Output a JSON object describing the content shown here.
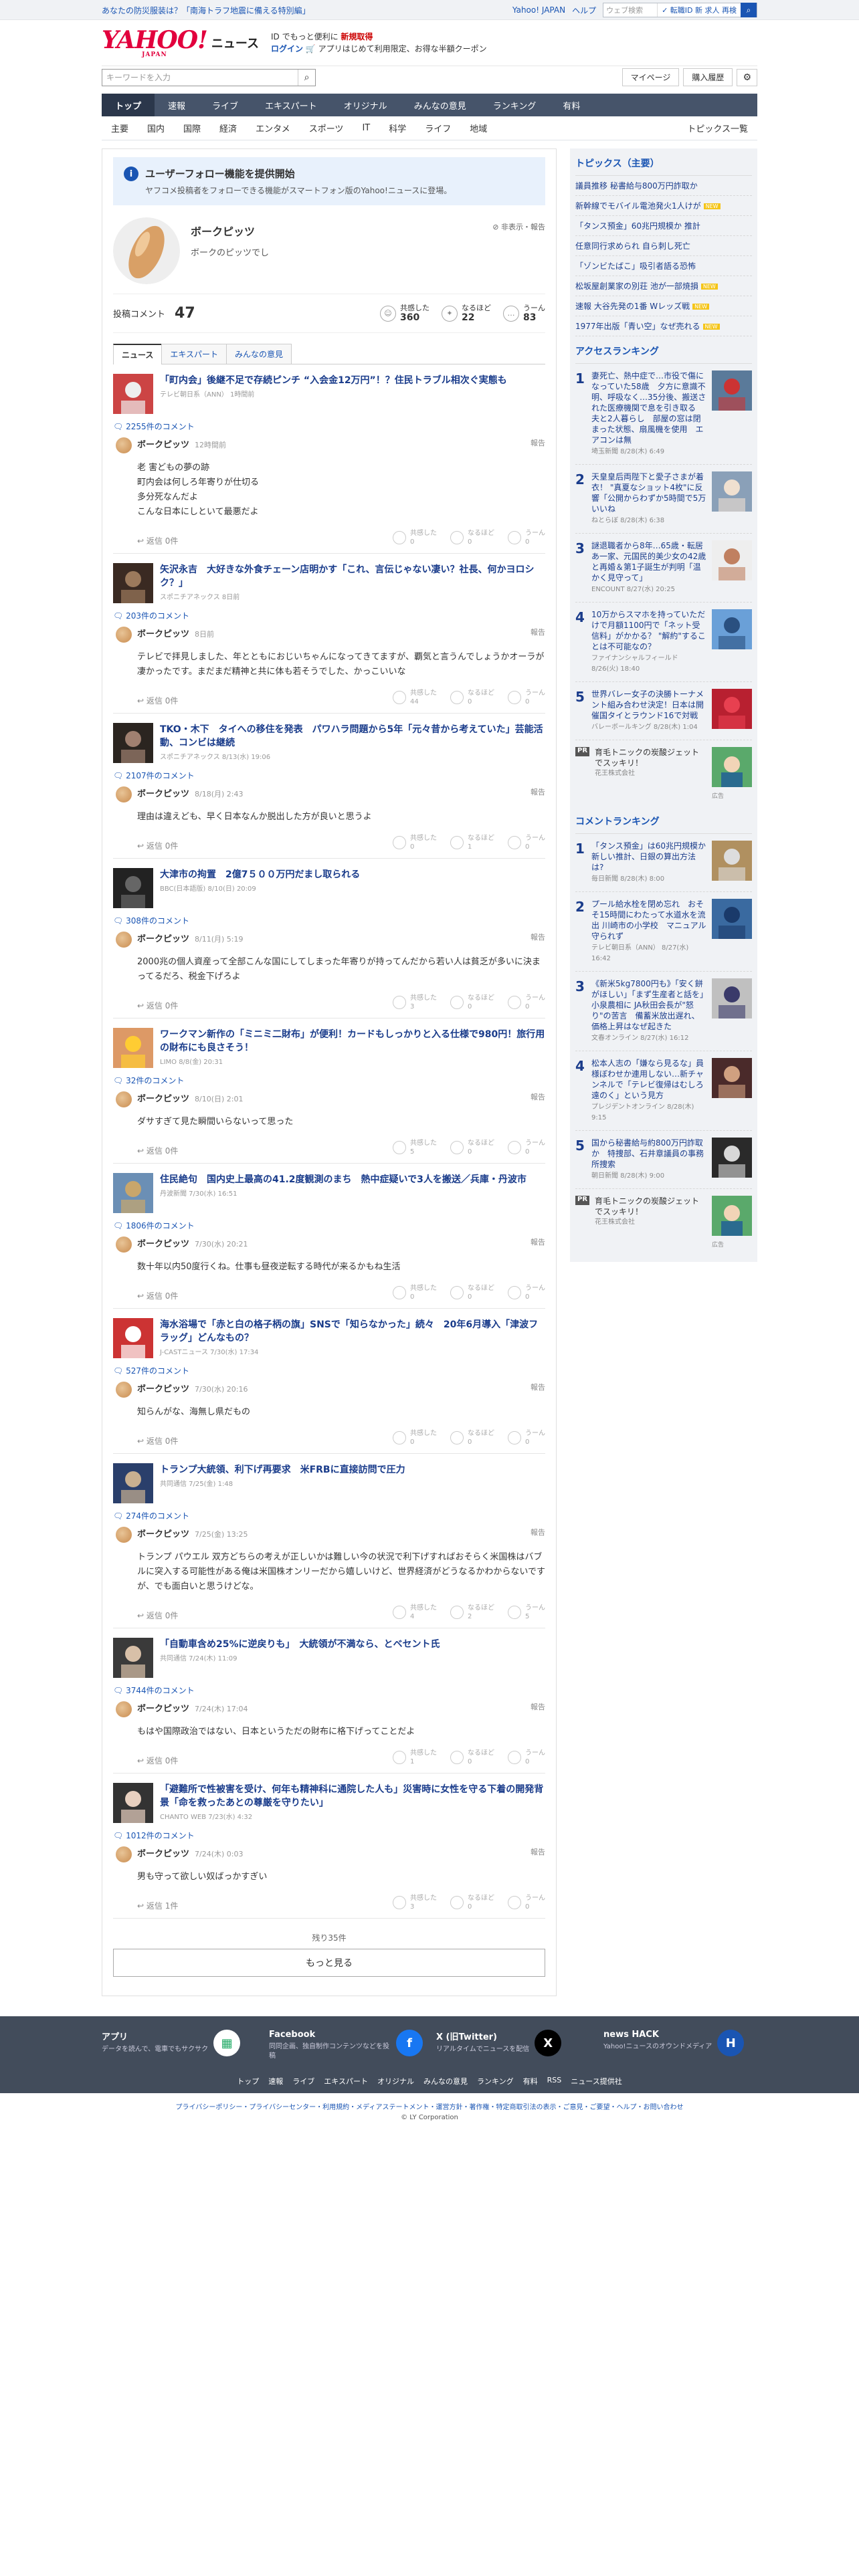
{
  "topbar": {
    "promo": "あなたの防災服装は？「南海トラフ地震に備える特別編」",
    "yahoo_japan": "Yahoo! JAPAN",
    "help": "ヘルプ",
    "search_placeholder": "ウェブ検索",
    "search_scope": "✓ 転職ID 新 求人 再検",
    "search_label": "検索"
  },
  "header": {
    "logo": "YAHOO!",
    "logo_sub": "JAPAN",
    "news": "ニュース",
    "msg1_pre": "ID でもっと便利に",
    "msg1_link": "新規取得",
    "msg2_link": "ログイン",
    "msg2_rest": "🛒 アプリはじめて利用限定、お得な半額クーポン",
    "kw_placeholder": "キーワードを入力",
    "mypage": "マイページ",
    "history": "購入履歴"
  },
  "gnav": [
    "トップ",
    "速報",
    "ライブ",
    "エキスパート",
    "オリジナル",
    "みんなの意見",
    "ランキング",
    "有料"
  ],
  "snav": [
    "主要",
    "国内",
    "国際",
    "経済",
    "エンタメ",
    "スポーツ",
    "IT",
    "科学",
    "ライフ",
    "地域"
  ],
  "snav_right": "トピックス一覧",
  "notice": {
    "title": "ユーザーフォロー機能を提供開始",
    "desc": "ヤフコメ投稿者をフォローできる機能がスマートフォン版のYahoo!ニュースに登場。"
  },
  "profile": {
    "name": "ボークピッツ",
    "bio": "ボークのピッツでし",
    "report": "非表示・報告"
  },
  "stats": {
    "label": "投稿コメント",
    "count": "47",
    "kyokan_label": "共感した",
    "kyokan": "360",
    "naruhodo_label": "なるほど",
    "naruhodo": "22",
    "uun_label": "うーん",
    "uun": "83"
  },
  "tabs": [
    "ニュース",
    "エキスパート",
    "みんなの意見"
  ],
  "entries": [
    {
      "title": "「町内会」後継不足で存続ピンチ “入会金12万円”！？住民トラブル相次ぐ実態も",
      "source": "テレビ朝日系（ANN） 1時間前",
      "count": "2255件のコメント",
      "time": "12時間前",
      "text": "老 害どもの夢の跡\n町内会は何しろ年寄りが仕切る\n多分死なんだよ\nこんな日本にしといて最悪だよ",
      "reply": "返信 0件",
      "r": [
        "0",
        "0",
        "0"
      ]
    },
    {
      "title": "矢沢永吉　大好きな外食チェーン店明かす「これ、言伝じゃない凄い？社長、何かヨロシク？」",
      "source": "スポニチアネックス 8日前",
      "count": "203件のコメント",
      "time": "8日前",
      "text": "テレビで拝見しました、年とともにおじいちゃんになってきてますが、覇気と言うんでしょうかオーラが凄かったです。まだまだ精神と共に体も若そうでした、かっこいいな",
      "reply": "返信 0件",
      "r": [
        "44",
        "0",
        "0"
      ]
    },
    {
      "title": "TKO・木下　タイへの移住を発表　パワハラ問題から5年「元々昔から考えていた」芸能活動、コンビは継続",
      "source": "スポニチアネックス 8/13(水) 19:06",
      "count": "2107件のコメント",
      "time": "8/18(月) 2:43",
      "text": "理由は違えども、早く日本なんか脱出した方が良いと思うよ",
      "reply": "返信 0件",
      "r": [
        "0",
        "1",
        "0"
      ]
    },
    {
      "title": "大津市の拘置　2億7５００万円だまし取られる",
      "source": "BBC(日本語版) 8/10(日) 20:09",
      "count": "308件のコメント",
      "time": "8/11(月) 5:19",
      "text": "2000兆の個人資産って全部こんな国にしてしまった年寄りが持ってんだから若い人は貧乏が多いに決まってるだろ、税金下げろよ",
      "reply": "返信 0件",
      "r": [
        "3",
        "0",
        "0"
      ]
    },
    {
      "title": "ワークマン新作の「ミニミ二財布」が便利！カードもしっかりと入る仕様で980円！旅行用の財布にも良さそう！",
      "source": "LIMO 8/8(金) 20:31",
      "count": "32件のコメント",
      "time": "8/10(日) 2:01",
      "text": "ダサすぎて見た瞬間いらないって思った",
      "reply": "返信 0件",
      "r": [
        "5",
        "0",
        "0"
      ]
    },
    {
      "title": "住民絶句　国内史上最高の41.2度観測のまち　熱中症疑いで3人を搬送／兵庫・丹波市",
      "source": "丹波新聞 7/30(水) 16:51",
      "count": "1806件のコメント",
      "time": "7/30(水) 20:21",
      "text": "数十年以内50度行くね。仕事も昼夜逆転する時代が来るかもね生活",
      "reply": "返信 0件",
      "r": [
        "0",
        "0",
        "0"
      ]
    },
    {
      "title": "海水浴場で「赤と白の格子柄の旗」SNSで「知らなかった」続々　20年6月導入「津波フラッグ」どんなもの？",
      "source": "J-CASTニュース 7/30(水) 17:34",
      "count": "527件のコメント",
      "time": "7/30(水) 20:16",
      "text": "知らんがな、海無し県だもの",
      "reply": "返信 0件",
      "r": [
        "0",
        "0",
        "0"
      ]
    },
    {
      "title": "トランプ大統領、利下げ再要求　米FRBに直接訪問で圧力",
      "source": "共同通信 7/25(金) 1:48",
      "count": "274件のコメント",
      "time": "7/25(金) 13:25",
      "text": "トランプ パウエル 双方どちらの考えが正しいかは難しい今の状況で利下げすればおそらく米国株はバブルに突入する可能性がある俺は米国株オンリーだから嬉しいけど、世界経済がどうなるかわからないですが、でも面白いと思うけどな。",
      "reply": "返信 0件",
      "r": [
        "4",
        "2",
        "5"
      ]
    },
    {
      "title": "「自動車含め25%に逆戻りも」　大統領が不満なら、とベセント氏",
      "source": "共同通信 7/24(木) 11:09",
      "count": "3744件のコメント",
      "time": "7/24(木) 17:04",
      "text": "もはや国際政治ではない、日本というただの財布に格下げってことだよ",
      "reply": "返信 0件",
      "r": [
        "1",
        "0",
        "0"
      ]
    },
    {
      "title": "「避難所で性被害を受け、何年も精神科に通院した人も」災害時に女性を守る下着の開発背景「命を救ったあとの尊厳を守りたい」",
      "source": "CHANTO WEB 7/23(水) 4:32",
      "count": "1012件のコメント",
      "time": "7/24(木) 0:03",
      "text": "男も守って欲しい奴ばっかすぎい",
      "reply": "返信 1件",
      "r": [
        "3",
        "0",
        "0"
      ]
    }
  ],
  "more_remaining": "残り35件",
  "more_btn": "もっと見る",
  "right": {
    "topics_title": "トピックス（主要）",
    "topics": [
      {
        "t": "議員推移 秘書給与800万円詐取か",
        "badge": ""
      },
      {
        "t": "新幹線でモバイル電池発火1人けが",
        "badge": "NEW"
      },
      {
        "t": "「タンス預金」60兆円規模か 推計",
        "badge": ""
      },
      {
        "t": "任意同行求められ 自ら刺し死亡",
        "badge": ""
      },
      {
        "t": "「ゾンビたばこ」吸引者語る恐怖",
        "badge": ""
      },
      {
        "t": "松坂屋創業家の別荘 池が一部焼損",
        "badge": "NEW"
      },
      {
        "t": "速報 大谷先発の1番 Wレッズ戦",
        "badge": "NEW"
      },
      {
        "t": "1977年出版「青い空」なぜ売れる",
        "badge": "NEW"
      }
    ],
    "access_title": "アクセスランキング",
    "access": [
      {
        "t": "妻死亡、熱中症で…市役で傷になっていた58歳　夕方に意識不明、呼吸なく…35分後、搬送された医療機関で息を引き取る　夫と2人暮らし　部屋の窓は閉まった状態、扇風機を使用　エアコンは無",
        "s": "埼玉新聞 8/28(木) 6:49"
      },
      {
        "t": "天皇皇后両陛下と愛子さまが着衣！ \"真夏なショット4枚\"に反響「公開からわずか5時間で5万いいね",
        "s": "ねとらぼ 8/28(木) 6:38"
      },
      {
        "t": "謎退職者から8年…65歳・転居あ一家、元国民的美少女の42歳と再婚＆第1子誕生が判明「温かく見守って」",
        "s": "ENCOUNT 8/27(水) 20:25"
      },
      {
        "t": "10万からスマホを持っていただけで月額1100円で「ネット受信料」がかかる？ \"解約\"することは不可能なの？",
        "s": "ファイナンシャルフィールド 8/26(火) 18:40"
      },
      {
        "t": "世界バレー女子の決勝トーナメント組み合わせ決定！日本は開催国タイとラウンド16で対戦",
        "s": "バレーボールキング 8/28(木) 1:04"
      }
    ],
    "pr1": {
      "t": "育毛トニックの炭酸ジェットでスッキリ！",
      "s": "花王株式会社",
      "ad": "広告"
    },
    "comment_title": "コメントランキング",
    "comment": [
      {
        "t": "「タンス預金」は60兆円規模か　新しい推計、日銀の算出方法は?",
        "s": "毎日新聞 8/28(木) 8:00"
      },
      {
        "t": "プール給水栓を閉め忘れ　おそそ15時間にわたって水道水を流出 川崎市の小学校　マニュアル守られず",
        "s": "テレビ朝日系（ANN） 8/27(水) 16:42"
      },
      {
        "t": "《新米5kg7800円も》「安く餅がほしい」「まず生産者と話を」小泉農相に JA秋田会長が\"怒り\"の苦言　備蓄米放出遅れ、価格上昇はなぜ起きた",
        "s": "文春オンライン 8/27(水) 16:12"
      },
      {
        "t": "松本人志の「嫌なら見るな」員様ぼわせか連用しない…新チャンネルで「テレビ復帰はむしろ遠のく」という見方",
        "s": "プレジデントオンライン 8/28(木) 9:15"
      },
      {
        "t": "国から秘書給与約800万円詐取か　特捜部、石井章議員の事務所捜索",
        "s": "朝日新聞 8/28(木) 9:00"
      }
    ],
    "pr2": {
      "t": "育毛トニックの炭酸ジェットでスッキリ！",
      "s": "花王株式会社",
      "ad": "広告"
    }
  },
  "footer": {
    "apps": [
      {
        "t": "アプリ",
        "d": "データを読んで、電車でもサクサク"
      },
      {
        "t": "Facebook",
        "d": "同同企画、独自制作コンテンツなどを投稿"
      },
      {
        "t": "X (旧Twitter)",
        "d": "リアルタイムでニュースを配信"
      },
      {
        "t": "news HACK",
        "d": "Yahoo!ニュースのオウンドメディア"
      }
    ],
    "links": [
      "トップ",
      "速報",
      "ライブ",
      "エキスパート",
      "オリジナル",
      "みんなの意見",
      "ランキング",
      "有料",
      "RSS",
      "ニュース提供社"
    ],
    "legal": "プライバシーポリシー・プライバシーセンター・利用規約・メディアステートメント・運営方針・著作権・特定商取引法の表示・ご意見・ご要望・ヘルプ・お問い合わせ",
    "copy": "© LY Corporation"
  },
  "colors": {
    "accent": "#1a55b3",
    "brand": "#e2003d",
    "nav": "#46546a"
  }
}
